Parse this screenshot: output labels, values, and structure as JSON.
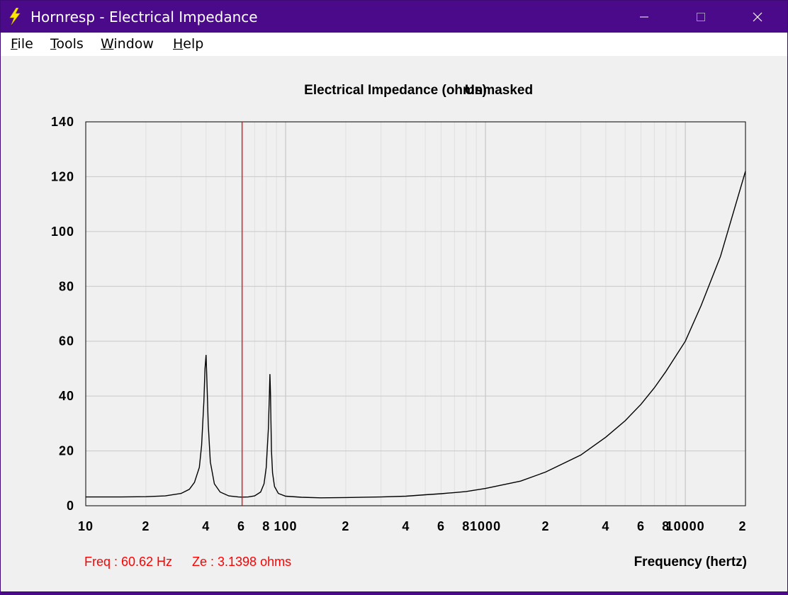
{
  "window": {
    "title": "Hornresp - Electrical Impedance",
    "app_icon": "lightning-icon",
    "controls": [
      "minimize-icon",
      "maximize-icon",
      "close-icon"
    ]
  },
  "menu": [
    {
      "accel": "F",
      "rest": "ile"
    },
    {
      "accel": "T",
      "rest": "ools"
    },
    {
      "accel": "W",
      "rest": "indow"
    },
    {
      "accel": "H",
      "rest": "elp"
    }
  ],
  "status": {
    "freq": "Freq : 60.62 Hz",
    "ze": "Ze : 3.1398 ohms",
    "color": "#ff0000"
  },
  "colors": {
    "titlebar": "#4a0a8a",
    "curve": "#000000",
    "cursor": "#ff0000",
    "grid": "#c8c8c8"
  },
  "chart_data": {
    "type": "line",
    "title": "Electrical Impedance (ohms)",
    "subtitle": "Unmasked",
    "xlabel": "Frequency (hertz)",
    "ylabel": "",
    "xscale": "log",
    "xlim": [
      10,
      20000
    ],
    "ylim": [
      0,
      140
    ],
    "yticks": [
      0,
      20,
      40,
      60,
      80,
      100,
      120,
      140
    ],
    "xtick_labels": [
      {
        "x": 10,
        "label": "10"
      },
      {
        "x": 20,
        "label": "2"
      },
      {
        "x": 40,
        "label": "4"
      },
      {
        "x": 60,
        "label": "6"
      },
      {
        "x": 80,
        "label": "8"
      },
      {
        "x": 100,
        "label": "100"
      },
      {
        "x": 200,
        "label": "2"
      },
      {
        "x": 400,
        "label": "4"
      },
      {
        "x": 600,
        "label": "6"
      },
      {
        "x": 800,
        "label": "8"
      },
      {
        "x": 1000,
        "label": "1000"
      },
      {
        "x": 2000,
        "label": "2"
      },
      {
        "x": 4000,
        "label": "4"
      },
      {
        "x": 6000,
        "label": "6"
      },
      {
        "x": 8000,
        "label": "8"
      },
      {
        "x": 10000,
        "label": "10000"
      },
      {
        "x": 20000,
        "label": "2"
      }
    ],
    "grid": true,
    "cursor_x": 60.62,
    "series": [
      {
        "name": "",
        "x": [
          10,
          15,
          20,
          25,
          30,
          33,
          35,
          37,
          38,
          39,
          39.5,
          40,
          40.5,
          41,
          42,
          44,
          47,
          52,
          58,
          60.62,
          65,
          70,
          75,
          78,
          80,
          82,
          83,
          83.5,
          84,
          84.5,
          85,
          86,
          88,
          92,
          100,
          120,
          150,
          200,
          300,
          400,
          500,
          600,
          700,
          800,
          1000,
          1500,
          2000,
          3000,
          4000,
          5000,
          6000,
          7000,
          8000,
          10000,
          12000,
          15000,
          20000
        ],
        "y": [
          3.2,
          3.2,
          3.3,
          3.6,
          4.5,
          6,
          8.5,
          14,
          22,
          38,
          50,
          55,
          43,
          30,
          16,
          8,
          5,
          3.6,
          3.2,
          3.14,
          3.2,
          3.6,
          5,
          8,
          14,
          28,
          41,
          48,
          41,
          30,
          20,
          12,
          7,
          4.5,
          3.5,
          3.1,
          2.9,
          3.0,
          3.2,
          3.5,
          4.0,
          4.4,
          4.8,
          5.2,
          6.3,
          9.0,
          12.3,
          18.5,
          25,
          31,
          37,
          43,
          49,
          60,
          73,
          91,
          122
        ]
      }
    ]
  }
}
